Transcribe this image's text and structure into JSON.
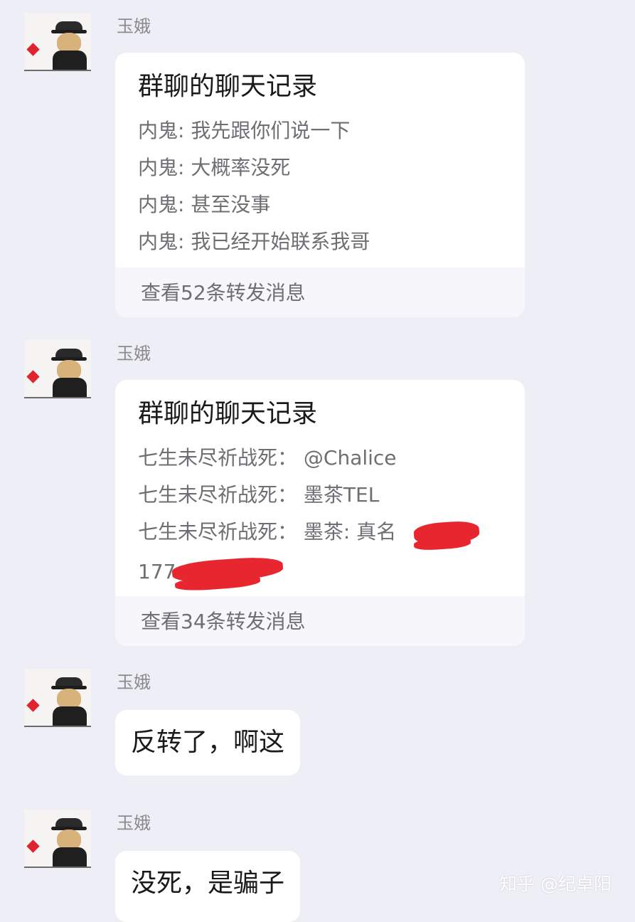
{
  "messages": [
    {
      "sender": "玉娥",
      "type": "forwarded",
      "title": "群聊的聊天记录",
      "lines": [
        "内鬼: 我先跟你们说一下",
        "内鬼: 大概率没死",
        "内鬼: 甚至没事",
        "内鬼: 我已经开始联系我哥"
      ],
      "footer": "查看52条转发消息"
    },
    {
      "sender": "玉娥",
      "type": "forwarded",
      "title": "群聊的聊天记录",
      "lines": [
        "七生未尽祈战死： @Chalice",
        "七生未尽祈战死： 墨茶TEL",
        "七生未尽祈战死： 墨茶: 真名",
        "177"
      ],
      "footer": "查看34条转发消息"
    },
    {
      "sender": "玉娥",
      "type": "text",
      "text": "反转了，啊这"
    },
    {
      "sender": "玉娥",
      "type": "text",
      "text": "没死，是骗子"
    }
  ],
  "watermark": "知乎 @纪卓阳",
  "colors": {
    "background": "#eeeff6",
    "redaction": "#e8262f"
  }
}
